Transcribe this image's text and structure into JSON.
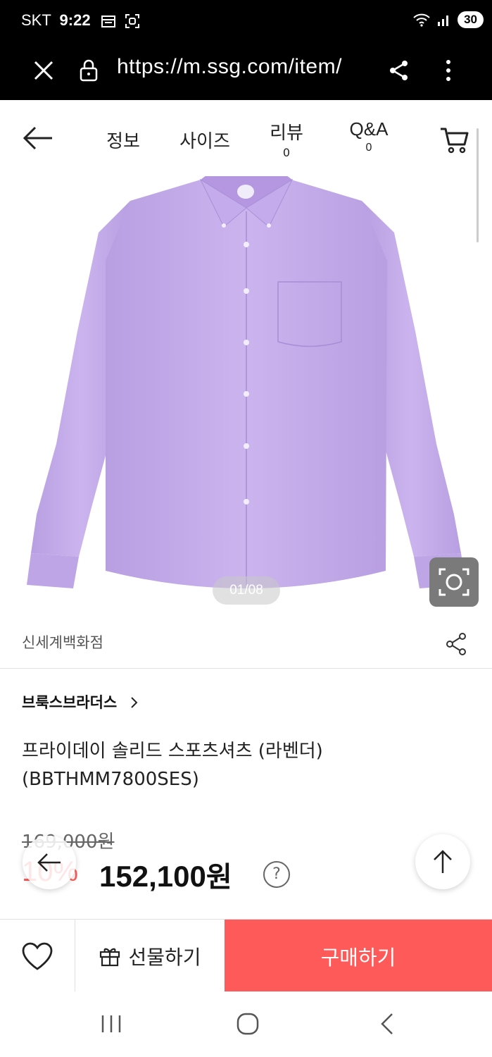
{
  "status_bar": {
    "carrier": "SKT",
    "time": "9:22",
    "battery": "30"
  },
  "browser": {
    "url": "https://m.ssg.com/item/"
  },
  "nav": {
    "tabs": [
      {
        "label": "정보"
      },
      {
        "label": "사이즈"
      },
      {
        "label": "리뷰",
        "count": "0"
      },
      {
        "label": "Q&A",
        "count": "0"
      }
    ]
  },
  "gallery": {
    "pager": "01/08",
    "shirt_color": "#c9b1eb"
  },
  "product": {
    "seller": "신세계백화점",
    "brand": "브룩스브라더스",
    "title": "프라이데이 솔리드 스포츠셔츠 (라벤더) (BBTHMM7800SES)",
    "original_price": "169,000원",
    "discount": "10%",
    "price_number": "152,100",
    "price_unit": "원"
  },
  "actions": {
    "gift": "선물하기",
    "buy": "구매하기"
  },
  "colors": {
    "accent": "#ff5a5a",
    "status_bg": "#000000"
  }
}
